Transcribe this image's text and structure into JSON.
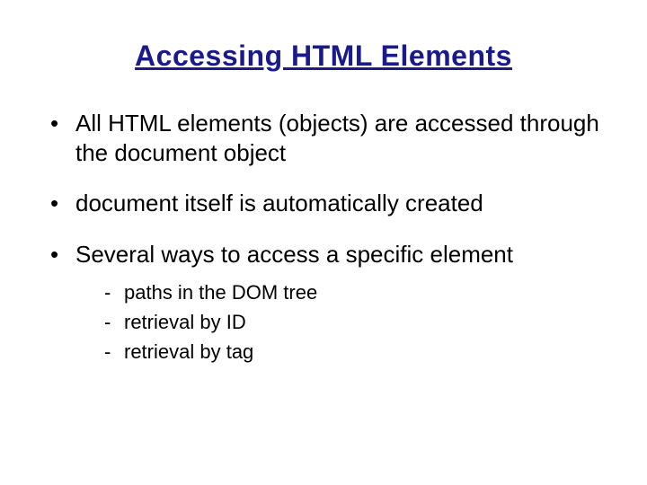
{
  "title": "Accessing HTML Elements",
  "bullets": [
    {
      "text": "All HTML elements (objects) are accessed through the document object"
    },
    {
      "text": "document itself is automatically created"
    },
    {
      "text": "Several ways to access a specific element",
      "sub": [
        "paths in the DOM tree",
        "retrieval by ID",
        "retrieval by tag"
      ]
    }
  ]
}
